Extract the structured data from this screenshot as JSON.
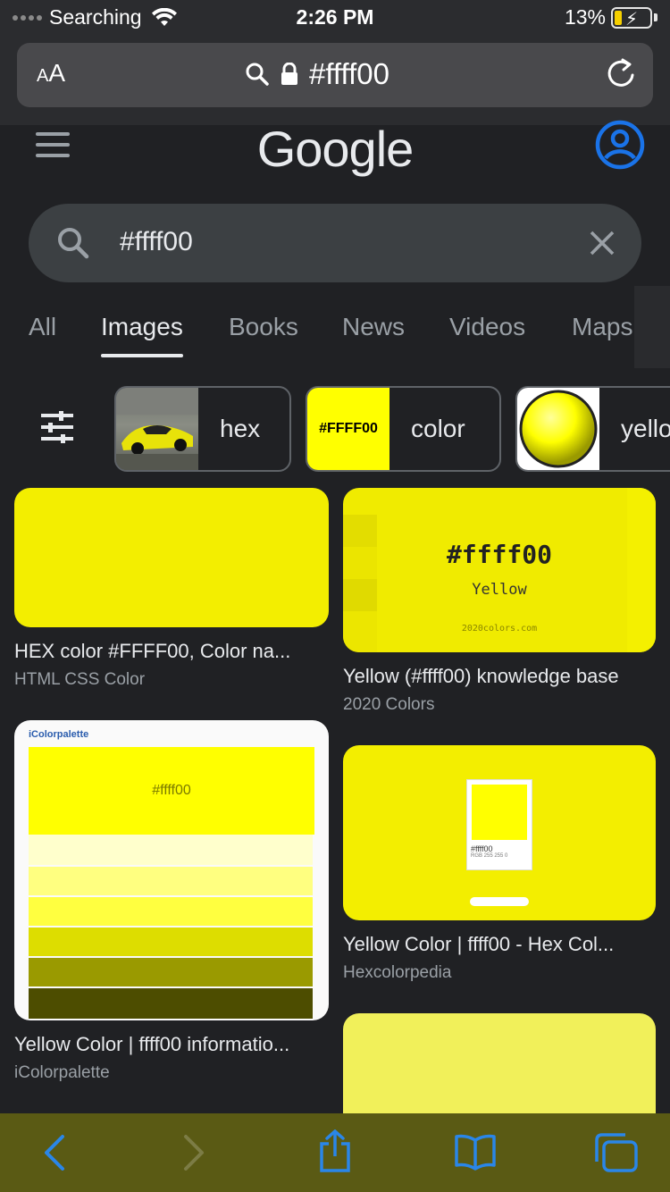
{
  "status_bar": {
    "carrier": "Searching",
    "time": "2:26 PM",
    "battery": "13%"
  },
  "url_bar": {
    "aa_label": "AA",
    "url": "#ffff00"
  },
  "google": {
    "logo": "Google"
  },
  "search": {
    "query": "#ffff00"
  },
  "tabs": [
    {
      "label": "All"
    },
    {
      "label": "Images"
    },
    {
      "label": "Books"
    },
    {
      "label": "News"
    },
    {
      "label": "Videos"
    },
    {
      "label": "Maps"
    }
  ],
  "chips": [
    {
      "label": "hex"
    },
    {
      "label": "color",
      "thumb_text": "#FFFF00"
    },
    {
      "label": "yello"
    }
  ],
  "results": [
    {
      "title": "HEX color #FFFF00, Color na...",
      "source": "HTML CSS Color"
    },
    {
      "title": "Yellow (#ffff00) knowledge base",
      "source": "2020 Colors",
      "image_text": "#ffff00",
      "image_sub": "Yellow",
      "image_site": "2020colors.com"
    },
    {
      "title": "Yellow Color | ffff00 informatio...",
      "source": "iColorpalette",
      "image_brand": "iColorpalette",
      "image_text": "#ffff00"
    },
    {
      "title": "Yellow Color | ffff00 - Hex Col...",
      "source": "Hexcolorpedia",
      "image_text": "#ffff00",
      "image_sub": "RGB 255 255 0"
    }
  ],
  "colors": {
    "yellow": "#f3ee00",
    "bright_yellow": "#ffff00",
    "accent_blue": "#1a73e8",
    "toolbar_icon": "#2a86e8"
  }
}
